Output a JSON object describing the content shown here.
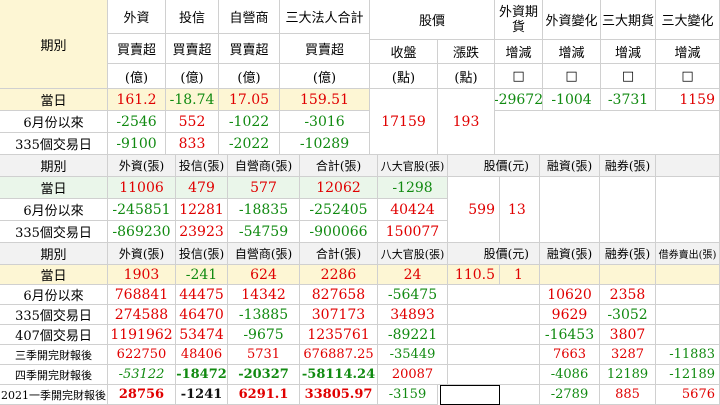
{
  "section1": {
    "period_label": "期別",
    "headers": {
      "foreign": "外資",
      "trust": "投信",
      "dealer": "自營商",
      "total3": "三大法人合計",
      "price": "股價",
      "fut_foreign": "外資期貨",
      "fut_foreign_chg": "外資變化",
      "fut_big3": "三大期貨",
      "fut_big3_chg": "三大變化"
    },
    "sub_buysell": "買賣超",
    "sub_unit": "(億)",
    "sub_close": "收盤",
    "sub_close_unit": "(點)",
    "sub_change": "漲跌",
    "sub_change_unit": "(點)",
    "sub_inc": "增減",
    "sub_box": "□",
    "rows": [
      {
        "label": "當日",
        "foreign": "161.2",
        "trust": "-18.74",
        "dealer": "17.05",
        "total": "159.51"
      },
      {
        "label": "6月份以來",
        "foreign": "-2546",
        "trust": "552",
        "dealer": "-1022",
        "total": "-3016"
      },
      {
        "label": "335個交易日",
        "foreign": "-9100",
        "trust": "833",
        "dealer": "-2022",
        "total": "-10289"
      }
    ],
    "close": "17159",
    "change": "193",
    "futures": {
      "fut_foreign": "-29672",
      "fut_foreign_chg": "-1004",
      "fut_big3": "-3731",
      "fut_big3_chg": "1159"
    }
  },
  "section2": {
    "period_label": "期別",
    "headers": {
      "foreign": "外資(張)",
      "trust": "投信(張)",
      "dealer": "自營商(張)",
      "total": "合計(張)",
      "eight": "八大官股(張)",
      "price": "股價(元)",
      "margin": "融資(張)",
      "short": "融券(張)"
    },
    "rows": [
      {
        "label": "當日",
        "foreign": "11006",
        "trust": "479",
        "dealer": "577",
        "total": "12062",
        "eight": "-1298"
      },
      {
        "label": "6月份以來",
        "foreign": "-245851",
        "trust": "12281",
        "dealer": "-18835",
        "total": "-252405",
        "eight": "40424"
      },
      {
        "label": "335個交易日",
        "foreign": "-869230",
        "trust": "23923",
        "dealer": "-54759",
        "total": "-900066",
        "eight": "150077"
      }
    ],
    "price": "599",
    "change": "13"
  },
  "section3": {
    "period_label": "期別",
    "headers": {
      "foreign": "外資(張)",
      "trust": "投信(張)",
      "dealer": "自營商(張)",
      "total": "合計(張)",
      "eight": "八大官股(張)",
      "price": "股價(元)",
      "margin": "融資(張)",
      "short": "融券(張)",
      "lend": "借券賣出(張)"
    },
    "rows": [
      {
        "label": "當日",
        "foreign": "1903",
        "trust": "-241",
        "dealer": "624",
        "total": "2286",
        "eight": "24",
        "margin": "",
        "short": "",
        "lend": ""
      },
      {
        "label": "6月份以來",
        "foreign": "768841",
        "trust": "44475",
        "dealer": "14342",
        "total": "827658",
        "eight": "-56475",
        "margin": "10620",
        "short": "2358",
        "lend": ""
      },
      {
        "label": "335個交易日",
        "foreign": "274588",
        "trust": "46470",
        "dealer": "-13885",
        "total": "307173",
        "eight": "34893",
        "margin": "9629",
        "short": "-3052",
        "lend": ""
      },
      {
        "label": "407個交易日",
        "foreign": "1191962",
        "trust": "53474",
        "dealer": "-9675",
        "total": "1235761",
        "eight": "-89221",
        "margin": "-16453",
        "short": "3807",
        "lend": ""
      },
      {
        "label": "三季開完財報後",
        "foreign": "622750",
        "trust": "48406",
        "dealer": "5731",
        "total": "676887.25",
        "eight": "-35449",
        "margin": "7663",
        "short": "3287",
        "lend": "-11883"
      },
      {
        "label": "四季開完財報後",
        "foreign": "-53122",
        "trust": "-18472",
        "dealer": "-20327",
        "total": "-58114.24",
        "eight": "20087",
        "margin": "-4086",
        "short": "12189",
        "lend": "-12189"
      },
      {
        "label": "2021一季開完財報後",
        "foreign": "28756",
        "trust": "-1241",
        "dealer": "6291.1",
        "total": "33805.97",
        "eight": "-3159",
        "margin": "-2789",
        "short": "885",
        "lend": "5676"
      }
    ],
    "price": "110.5",
    "change": "1"
  }
}
